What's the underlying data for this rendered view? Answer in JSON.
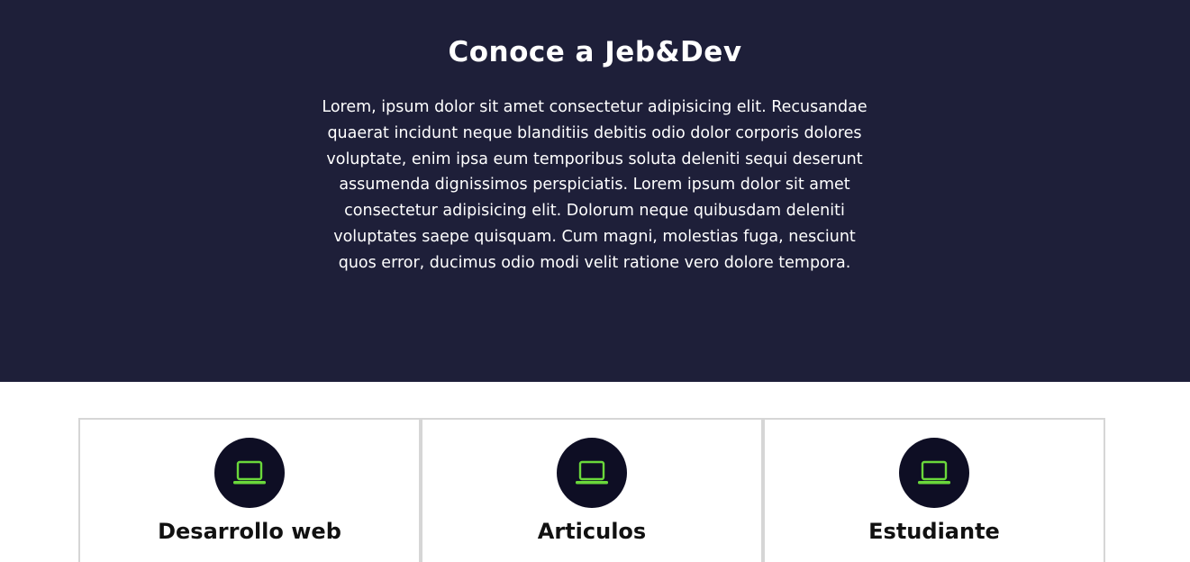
{
  "about": {
    "title": "Conoce a Jeb&Dev",
    "paragraph": "Lorem, ipsum dolor sit amet consectetur adipisicing elit. Recusandae quaerat incidunt neque blanditiis debitis odio dolor corporis dolores voluptate, enim ipsa eum temporibus soluta deleniti sequi deserunt assumenda dignissimos perspiciatis. Lorem ipsum dolor sit amet consectetur adipisicing elit. Dolorum neque quibusdam deleniti voluptates saepe quisquam. Cum magni, molestias fuga, nesciunt quos error, ducimus odio modi velit ratione vero dolore tempora."
  },
  "colors": {
    "hero_background": "#1e1f39",
    "icon_circle": "#0e0e24",
    "icon_accent": "#6ad83b"
  },
  "cards": [
    {
      "icon": "laptop-icon",
      "title": "Desarrollo web"
    },
    {
      "icon": "laptop-icon",
      "title": "Articulos"
    },
    {
      "icon": "laptop-icon",
      "title": "Estudiante"
    }
  ]
}
